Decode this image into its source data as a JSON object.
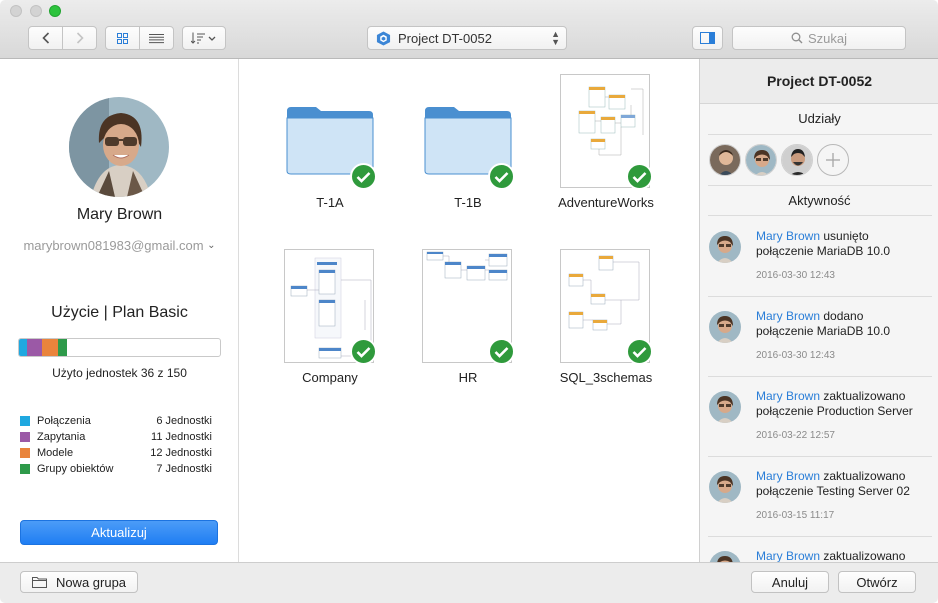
{
  "toolbar": {
    "project_name": "Project DT-0052",
    "search_placeholder": "Szukaj"
  },
  "user": {
    "name": "Mary Brown",
    "email": "marybrown081983@gmail.com"
  },
  "usage": {
    "title": "Użycie | Plan Basic",
    "used_text": "Użyto jednostek 36 z 150",
    "used": 36,
    "total": 150,
    "legend": [
      {
        "label": "Połączenia",
        "value": "6 Jednostki",
        "units": 6,
        "color": "#1fa8e0"
      },
      {
        "label": "Zapytania",
        "value": "11 Jednostki",
        "units": 11,
        "color": "#9b59a6"
      },
      {
        "label": "Modele",
        "value": "12 Jednostki",
        "units": 12,
        "color": "#e9843c"
      },
      {
        "label": "Grupy obiektów",
        "value": "7 Jednostki",
        "units": 7,
        "color": "#2e9a4a"
      }
    ],
    "update_label": "Aktualizuj"
  },
  "items": [
    {
      "label": "T-1A",
      "kind": "folder"
    },
    {
      "label": "T-1B",
      "kind": "folder"
    },
    {
      "label": "AdventureWorks",
      "kind": "model"
    },
    {
      "label": "Company",
      "kind": "model"
    },
    {
      "label": "HR",
      "kind": "model"
    },
    {
      "label": "SQL_3schemas",
      "kind": "model"
    }
  ],
  "right": {
    "title": "Project DT-0052",
    "shares_label": "Udziały",
    "activity_label": "Aktywność",
    "activities": [
      {
        "user": "Mary Brown",
        "action": "usunięto",
        "detail": "połączenie MariaDB 10.0",
        "time": "2016-03-30 12:43"
      },
      {
        "user": "Mary Brown",
        "action": "dodano",
        "detail": "połączenie MariaDB 10.0",
        "time": "2016-03-30 12:43"
      },
      {
        "user": "Mary Brown",
        "action": "zaktualizowano",
        "detail": "połączenie Production Server",
        "time": "2016-03-22 12:57"
      },
      {
        "user": "Mary Brown",
        "action": "zaktualizowano",
        "detail": "połączenie Testing Server 02",
        "time": "2016-03-15 11:17"
      },
      {
        "user": "Mary Brown",
        "action": "zaktualizowano",
        "detail": "",
        "time": ""
      }
    ]
  },
  "bottom": {
    "new_group_label": "Nowa grupa",
    "cancel_label": "Anuluj",
    "open_label": "Otwórz"
  },
  "colors": {
    "accent": "#2a7ed8",
    "check_green": "#2f9a3c",
    "update_button": "#1f7ef3"
  }
}
